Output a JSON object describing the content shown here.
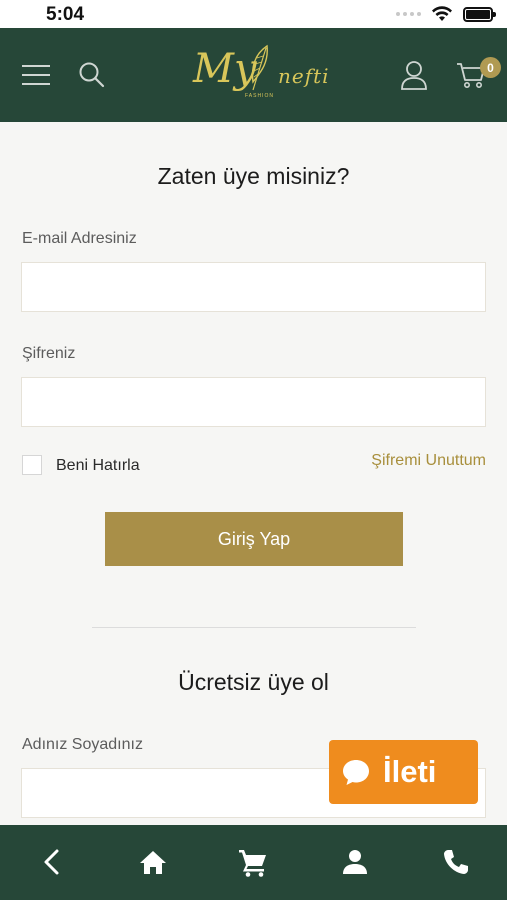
{
  "status_bar": {
    "time": "5:04"
  },
  "header": {
    "logo_text_my": "My",
    "logo_text_nefti": "nefti",
    "logo_text_fashion": "FASHION",
    "cart_count": "0",
    "icons": [
      "menu-icon",
      "search-icon",
      "user-icon",
      "cart-icon"
    ]
  },
  "login": {
    "title": "Zaten üye misiniz?",
    "email_label": "E-mail Adresiniz",
    "email_value": "",
    "password_label": "Şifreniz",
    "password_value": "",
    "remember_label": "Beni Hatırla",
    "forgot_label": "Şifremi Unuttum",
    "submit_label": "Giriş Yap"
  },
  "register": {
    "title": "Ücretsiz üye ol",
    "name_label": "Adınız Soyadınız",
    "name_value": ""
  },
  "chat": {
    "label": "İleti"
  },
  "bottom_nav": {
    "icons": [
      "back-icon",
      "home-icon",
      "cart-icon",
      "account-icon",
      "phone-icon"
    ]
  },
  "colors": {
    "header_bg": "#264738",
    "accent_gold": "#a98f48",
    "chat_orange": "#ef8c1e",
    "page_bg": "#f6f6f4"
  }
}
